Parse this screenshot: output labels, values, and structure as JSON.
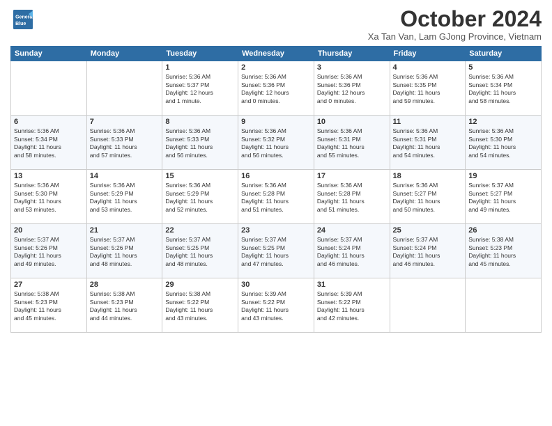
{
  "header": {
    "logo_line1": "General",
    "logo_line2": "Blue",
    "month_title": "October 2024",
    "location": "Xa Tan Van, Lam GJong Province, Vietnam"
  },
  "days_of_week": [
    "Sunday",
    "Monday",
    "Tuesday",
    "Wednesday",
    "Thursday",
    "Friday",
    "Saturday"
  ],
  "weeks": [
    [
      {
        "day": "",
        "info": ""
      },
      {
        "day": "",
        "info": ""
      },
      {
        "day": "1",
        "info": "Sunrise: 5:36 AM\nSunset: 5:37 PM\nDaylight: 12 hours\nand 1 minute."
      },
      {
        "day": "2",
        "info": "Sunrise: 5:36 AM\nSunset: 5:36 PM\nDaylight: 12 hours\nand 0 minutes."
      },
      {
        "day": "3",
        "info": "Sunrise: 5:36 AM\nSunset: 5:36 PM\nDaylight: 12 hours\nand 0 minutes."
      },
      {
        "day": "4",
        "info": "Sunrise: 5:36 AM\nSunset: 5:35 PM\nDaylight: 11 hours\nand 59 minutes."
      },
      {
        "day": "5",
        "info": "Sunrise: 5:36 AM\nSunset: 5:34 PM\nDaylight: 11 hours\nand 58 minutes."
      }
    ],
    [
      {
        "day": "6",
        "info": "Sunrise: 5:36 AM\nSunset: 5:34 PM\nDaylight: 11 hours\nand 58 minutes."
      },
      {
        "day": "7",
        "info": "Sunrise: 5:36 AM\nSunset: 5:33 PM\nDaylight: 11 hours\nand 57 minutes."
      },
      {
        "day": "8",
        "info": "Sunrise: 5:36 AM\nSunset: 5:33 PM\nDaylight: 11 hours\nand 56 minutes."
      },
      {
        "day": "9",
        "info": "Sunrise: 5:36 AM\nSunset: 5:32 PM\nDaylight: 11 hours\nand 56 minutes."
      },
      {
        "day": "10",
        "info": "Sunrise: 5:36 AM\nSunset: 5:31 PM\nDaylight: 11 hours\nand 55 minutes."
      },
      {
        "day": "11",
        "info": "Sunrise: 5:36 AM\nSunset: 5:31 PM\nDaylight: 11 hours\nand 54 minutes."
      },
      {
        "day": "12",
        "info": "Sunrise: 5:36 AM\nSunset: 5:30 PM\nDaylight: 11 hours\nand 54 minutes."
      }
    ],
    [
      {
        "day": "13",
        "info": "Sunrise: 5:36 AM\nSunset: 5:30 PM\nDaylight: 11 hours\nand 53 minutes."
      },
      {
        "day": "14",
        "info": "Sunrise: 5:36 AM\nSunset: 5:29 PM\nDaylight: 11 hours\nand 53 minutes."
      },
      {
        "day": "15",
        "info": "Sunrise: 5:36 AM\nSunset: 5:29 PM\nDaylight: 11 hours\nand 52 minutes."
      },
      {
        "day": "16",
        "info": "Sunrise: 5:36 AM\nSunset: 5:28 PM\nDaylight: 11 hours\nand 51 minutes."
      },
      {
        "day": "17",
        "info": "Sunrise: 5:36 AM\nSunset: 5:28 PM\nDaylight: 11 hours\nand 51 minutes."
      },
      {
        "day": "18",
        "info": "Sunrise: 5:36 AM\nSunset: 5:27 PM\nDaylight: 11 hours\nand 50 minutes."
      },
      {
        "day": "19",
        "info": "Sunrise: 5:37 AM\nSunset: 5:27 PM\nDaylight: 11 hours\nand 49 minutes."
      }
    ],
    [
      {
        "day": "20",
        "info": "Sunrise: 5:37 AM\nSunset: 5:26 PM\nDaylight: 11 hours\nand 49 minutes."
      },
      {
        "day": "21",
        "info": "Sunrise: 5:37 AM\nSunset: 5:26 PM\nDaylight: 11 hours\nand 48 minutes."
      },
      {
        "day": "22",
        "info": "Sunrise: 5:37 AM\nSunset: 5:25 PM\nDaylight: 11 hours\nand 48 minutes."
      },
      {
        "day": "23",
        "info": "Sunrise: 5:37 AM\nSunset: 5:25 PM\nDaylight: 11 hours\nand 47 minutes."
      },
      {
        "day": "24",
        "info": "Sunrise: 5:37 AM\nSunset: 5:24 PM\nDaylight: 11 hours\nand 46 minutes."
      },
      {
        "day": "25",
        "info": "Sunrise: 5:37 AM\nSunset: 5:24 PM\nDaylight: 11 hours\nand 46 minutes."
      },
      {
        "day": "26",
        "info": "Sunrise: 5:38 AM\nSunset: 5:23 PM\nDaylight: 11 hours\nand 45 minutes."
      }
    ],
    [
      {
        "day": "27",
        "info": "Sunrise: 5:38 AM\nSunset: 5:23 PM\nDaylight: 11 hours\nand 45 minutes."
      },
      {
        "day": "28",
        "info": "Sunrise: 5:38 AM\nSunset: 5:23 PM\nDaylight: 11 hours\nand 44 minutes."
      },
      {
        "day": "29",
        "info": "Sunrise: 5:38 AM\nSunset: 5:22 PM\nDaylight: 11 hours\nand 43 minutes."
      },
      {
        "day": "30",
        "info": "Sunrise: 5:39 AM\nSunset: 5:22 PM\nDaylight: 11 hours\nand 43 minutes."
      },
      {
        "day": "31",
        "info": "Sunrise: 5:39 AM\nSunset: 5:22 PM\nDaylight: 11 hours\nand 42 minutes."
      },
      {
        "day": "",
        "info": ""
      },
      {
        "day": "",
        "info": ""
      }
    ]
  ]
}
